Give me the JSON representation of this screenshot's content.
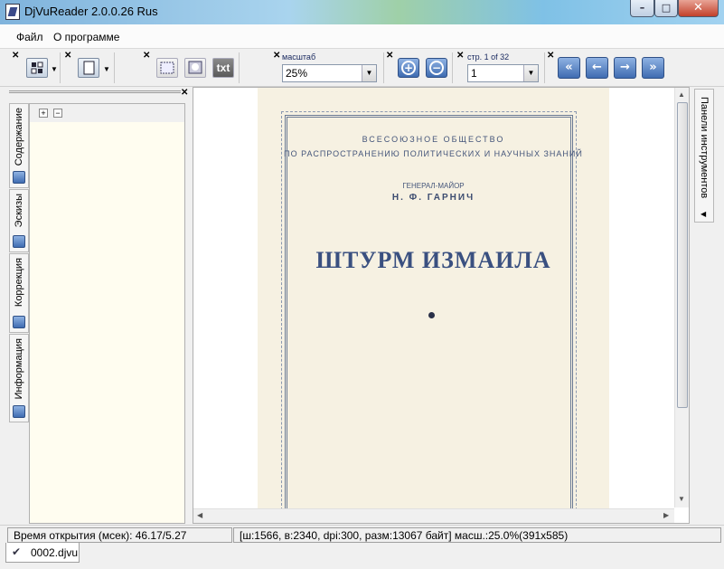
{
  "window": {
    "title": "DjVuReader 2.0.0.26 Rus",
    "minimize": "–",
    "maximize": "□",
    "close": "✕"
  },
  "menu": {
    "items": [
      "Файл",
      "О программе"
    ]
  },
  "toolbar": {
    "close_glyph": "✕",
    "text_button": "txt",
    "zoom_label": "масштаб",
    "zoom_value": "25%",
    "page_label": "стр. 1 of 32",
    "page_value": "1",
    "zoom_in_glyph": "+",
    "zoom_out_glyph": "−",
    "nav": {
      "first": "«",
      "prev": "←",
      "next": "→",
      "last": "»"
    },
    "dropdown_glyph": "▼"
  },
  "left_panel": {
    "close_glyph": "✕",
    "tabs": [
      "Содержание",
      "Эскизы",
      "Коррекция",
      "Информация"
    ],
    "expand_all": "+",
    "collapse_all": "−"
  },
  "document_page": {
    "society_line1": "ВСЕСОЮЗНОЕ ОБЩЕСТВО",
    "society_line2": "ПО РАСПРОСТРАНЕНИЮ ПОЛИТИЧЕСКИХ И НАУЧНЫХ ЗНАНИЙ",
    "author_rank": "ГЕНЕРАЛ-МАЙОР",
    "author_name": "Н. Ф. ГАРНИЧ",
    "book_title": "ШТУРМ ИЗМАИЛА"
  },
  "right_panel": {
    "label": "Панели инструментов",
    "caret": "◀"
  },
  "status": {
    "open_time": "Время открытия (мсек): 46.17/5.27",
    "page_info": "[ш:1566, в:2340, dpi:300, разм:13067 байт] масш.:25.0%(391x585)"
  },
  "tabs": {
    "document": "0002.djvu",
    "check_glyph": "✔"
  },
  "scroll": {
    "up": "▲",
    "down": "▼",
    "left": "◀",
    "right": "▶"
  },
  "colors": {
    "accent": "#3f6cb1",
    "page": "#f6f1e2",
    "tree_bg": "#fffdf0"
  }
}
